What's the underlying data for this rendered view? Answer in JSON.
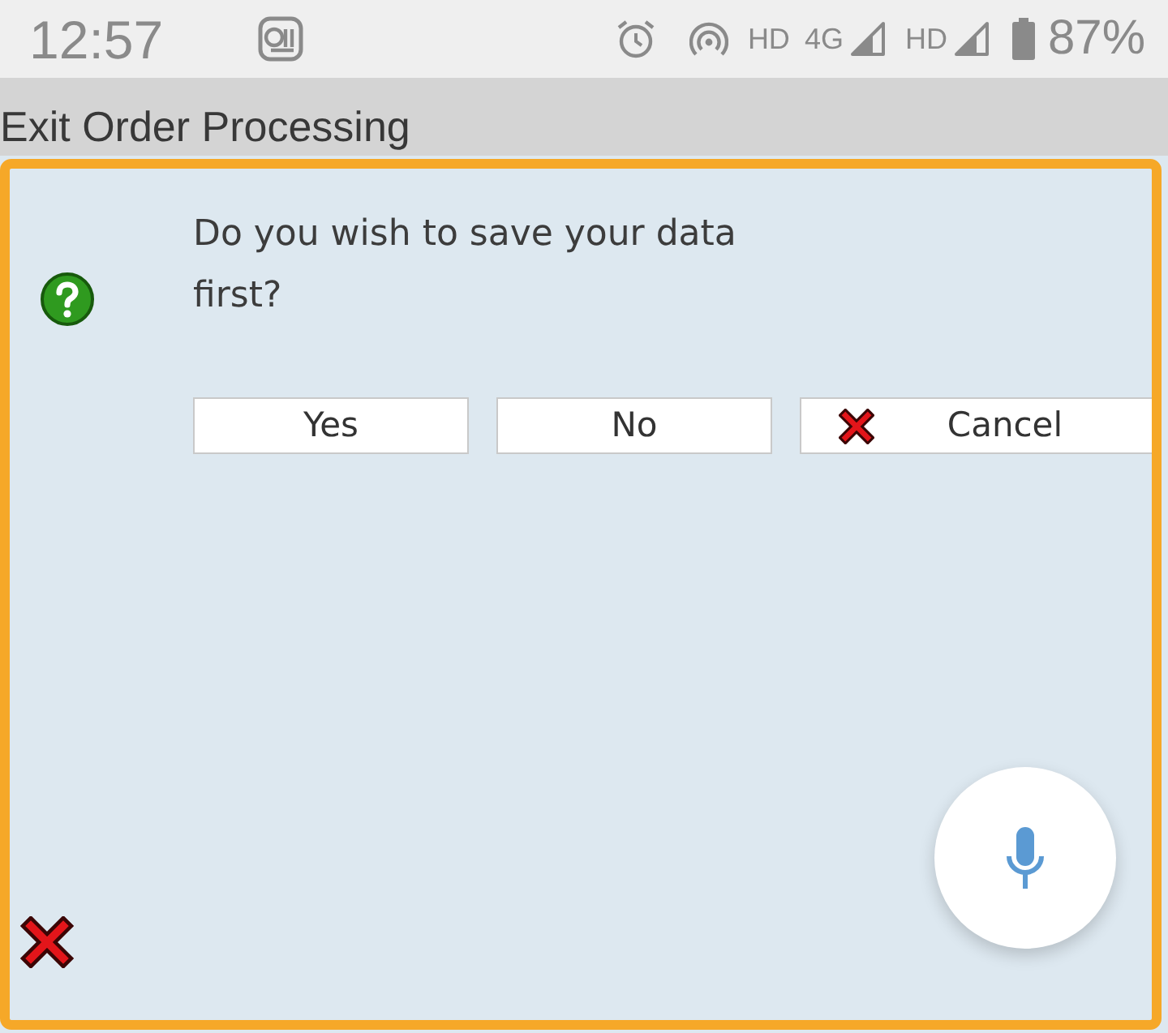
{
  "status_bar": {
    "time": "12:57",
    "sims": [
      {
        "labels": [
          "HD",
          "4G"
        ]
      },
      {
        "labels": [
          "HD"
        ]
      }
    ],
    "battery": "87%"
  },
  "title_bar": {
    "title": "Exit Order Processing"
  },
  "dialog": {
    "message": "Do you wish to save your data first?",
    "buttons": [
      {
        "label": "Yes",
        "kind": "plain"
      },
      {
        "label": "No",
        "kind": "plain"
      },
      {
        "label": "Cancel",
        "kind": "cancel"
      }
    ]
  }
}
